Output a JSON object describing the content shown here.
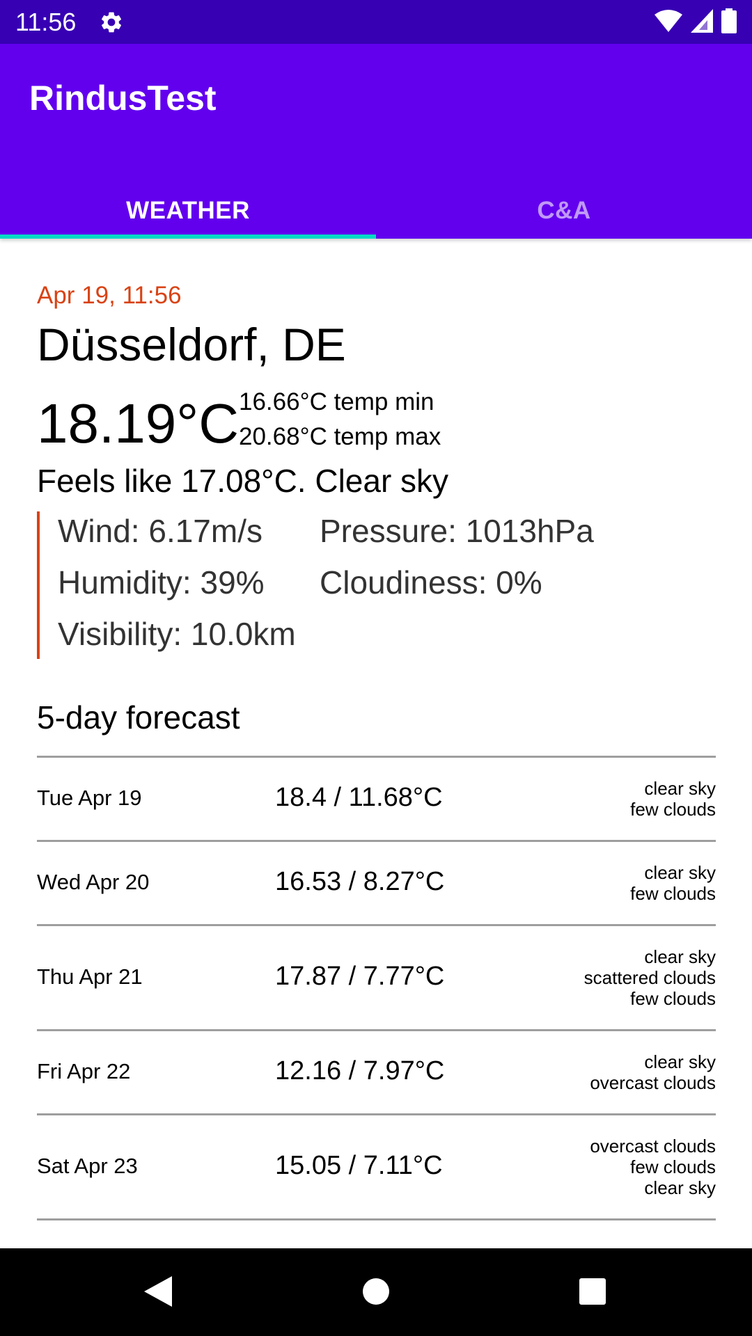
{
  "status_bar": {
    "time": "11:56",
    "icons": [
      "gear-icon",
      "wifi-icon",
      "signal-icon",
      "battery-icon"
    ]
  },
  "app_bar": {
    "title": "RindusTest",
    "tabs": [
      {
        "label": "WEATHER",
        "selected": true
      },
      {
        "label": "C&A",
        "selected": false
      }
    ],
    "colors": {
      "background": "#6200ee",
      "status": "#3700b3",
      "indicator": "#03dac5"
    }
  },
  "weather": {
    "date": "Apr 19, 11:56",
    "city": "Düsseldorf, DE",
    "temperature": "18.19°C",
    "temp_min": "16.66°C temp min",
    "temp_max": "20.68°C temp max",
    "feels_like": "Feels like 17.08°C. Clear sky",
    "details": {
      "wind": "Wind: 6.17m/s",
      "pressure": "Pressure: 1013hPa",
      "humidity": "Humidity: 39%",
      "cloudiness": "Cloudiness: 0%",
      "visibility": "Visibility: 10.0km"
    },
    "accent_color": "#d84315"
  },
  "forecast": {
    "title": "5-day forecast",
    "rows": [
      {
        "day": "Tue Apr 19",
        "temp": "18.4 / 11.68°C",
        "desc": [
          "clear sky",
          "few clouds"
        ]
      },
      {
        "day": "Wed Apr 20",
        "temp": "16.53 / 8.27°C",
        "desc": [
          "clear sky",
          "few clouds"
        ]
      },
      {
        "day": "Thu Apr 21",
        "temp": "17.87 / 7.77°C",
        "desc": [
          "clear sky",
          "scattered clouds",
          "few clouds"
        ]
      },
      {
        "day": "Fri Apr 22",
        "temp": "12.16 / 7.97°C",
        "desc": [
          "clear sky",
          "overcast clouds"
        ]
      },
      {
        "day": "Sat Apr 23",
        "temp": "15.05 / 7.11°C",
        "desc": [
          "overcast clouds",
          "few clouds",
          "clear sky"
        ]
      }
    ]
  },
  "nav_bar": {
    "buttons": [
      "back-icon",
      "home-icon",
      "recents-icon"
    ]
  }
}
